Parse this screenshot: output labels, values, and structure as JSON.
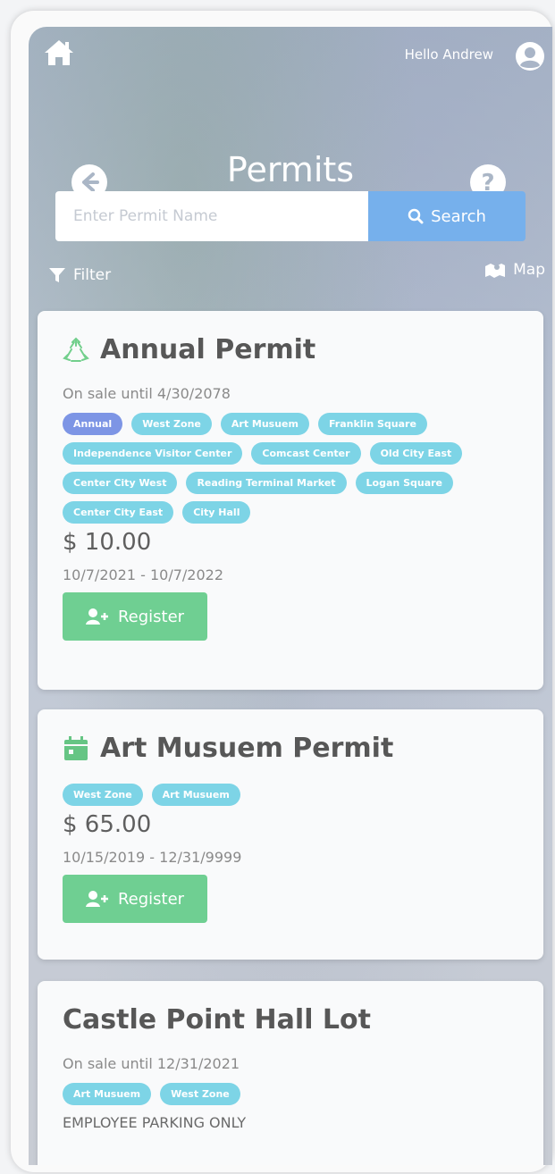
{
  "header": {
    "greeting": "Hello Andrew",
    "home_icon": "home-icon",
    "avatar_icon": "user-circle-icon"
  },
  "page": {
    "title": "Permits",
    "back_icon": "arrow-left-icon",
    "help_icon": "question-icon"
  },
  "search": {
    "placeholder": "Enter Permit Name",
    "value": "",
    "button_label": "Search"
  },
  "toolbar": {
    "filter_label": "Filter",
    "map_label": "Map"
  },
  "permits": [
    {
      "name": "Annual Permit",
      "icon": "recycle-icon",
      "sale_text": "On sale until 4/30/2078",
      "tags": [
        "Annual",
        "West Zone",
        "Art Musuem",
        "Franklin Square",
        "Independence Visitor Center",
        "Comcast Center",
        "Old City East",
        "Center City West",
        "Reading Terminal Market",
        "Logan Square",
        "Center City East",
        "City Hall"
      ],
      "price": "$ 10.00",
      "dates": "10/7/2021 - 10/7/2022",
      "register_label": "Register"
    },
    {
      "name": "Art Musuem Permit",
      "icon": "calendar-icon",
      "tags": [
        "West Zone",
        "Art Musuem"
      ],
      "price": "$ 65.00",
      "dates": "10/15/2019 - 12/31/9999",
      "register_label": "Register"
    },
    {
      "name": "Castle Point Hall Lot",
      "sale_text": "On sale until 12/31/2021",
      "tags": [
        "Art Musuem",
        "West Zone"
      ],
      "note": "EMPLOYEE PARKING ONLY"
    }
  ],
  "colors": {
    "search_button": "#76b0ec",
    "tag": "#7dd4e6",
    "tag_primary": "#7d95e5",
    "register_button": "#6fcf92",
    "recycle_icon": "#72cf8c",
    "calendar_icon": "#66c584"
  }
}
